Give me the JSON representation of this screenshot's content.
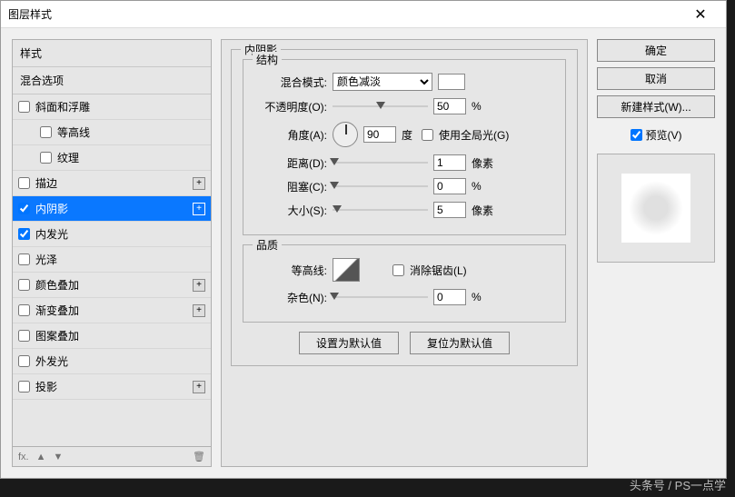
{
  "title": "图层样式",
  "close": "✕",
  "left": {
    "styles_header": "样式",
    "blend_opts": "混合选项",
    "items": [
      {
        "label": "斜面和浮雕",
        "plus": false
      },
      {
        "label": "等高线",
        "sub": true
      },
      {
        "label": "纹理",
        "sub": true
      },
      {
        "label": "描边",
        "plus": true
      },
      {
        "label": "内阴影",
        "plus": true,
        "selected": true,
        "checked": true
      },
      {
        "label": "内发光",
        "checked": true
      },
      {
        "label": "光泽"
      },
      {
        "label": "颜色叠加",
        "plus": true
      },
      {
        "label": "渐变叠加",
        "plus": true
      },
      {
        "label": "图案叠加"
      },
      {
        "label": "外发光"
      },
      {
        "label": "投影",
        "plus": true
      }
    ],
    "footer": {
      "fx": "fx.",
      "up": "▲",
      "down": "▼",
      "trash": "🗑"
    }
  },
  "panel": {
    "title": "内阴影",
    "struct": "结构",
    "blend_mode_label": "混合模式:",
    "blend_mode_value": "颜色减淡",
    "opacity_label": "不透明度(O):",
    "opacity_value": "50",
    "opacity_unit": "%",
    "angle_label": "角度(A):",
    "angle_value": "90",
    "angle_unit": "度",
    "global_light": "使用全局光(G)",
    "distance_label": "距离(D):",
    "distance_value": "1",
    "distance_unit": "像素",
    "choke_label": "阻塞(C):",
    "choke_value": "0",
    "choke_unit": "%",
    "size_label": "大小(S):",
    "size_value": "5",
    "size_unit": "像素",
    "quality": "品质",
    "contour_label": "等高线:",
    "antialias": "消除锯齿(L)",
    "noise_label": "杂色(N):",
    "noise_value": "0",
    "noise_unit": "%",
    "set_default": "设置为默认值",
    "reset_default": "复位为默认值"
  },
  "right": {
    "ok": "确定",
    "cancel": "取消",
    "new_style": "新建样式(W)...",
    "preview": "预览(V)"
  },
  "watermark": "头条号 / PS一点学"
}
